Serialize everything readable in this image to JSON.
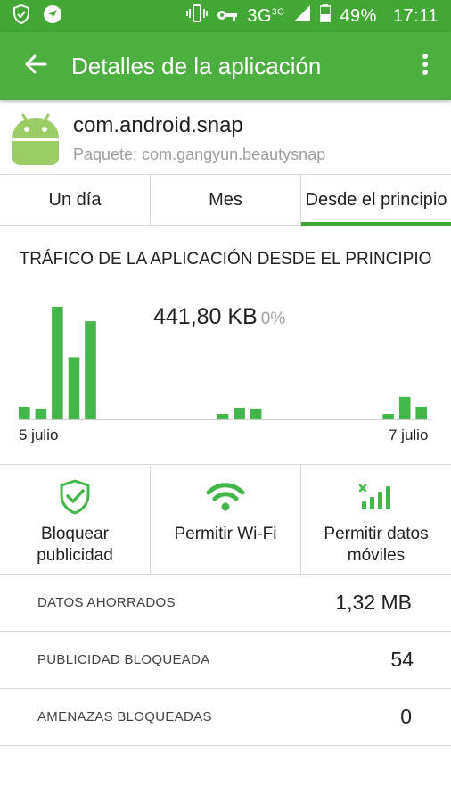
{
  "status_bar": {
    "network": "3G",
    "network_sup": "3G",
    "battery": "49%",
    "time": "17:11"
  },
  "app_bar": {
    "title": "Detalles de la aplicación"
  },
  "app": {
    "name": "com.android.snap",
    "package": "Paquete: com.gangyun.beautysnap"
  },
  "tabs": [
    {
      "label": "Un día",
      "active": false
    },
    {
      "label": "Mes",
      "active": false
    },
    {
      "label": "Desde el principio",
      "active": true
    }
  ],
  "traffic": {
    "title": "TRÁFICO DE LA APLICACIÓN DESDE EL PRINCIPIO",
    "total": "441,80 KB",
    "percent": "0%"
  },
  "chart_data": {
    "type": "bar",
    "x": [
      0,
      1,
      2,
      3,
      4,
      12,
      13,
      14,
      22,
      23,
      24
    ],
    "values": [
      14,
      12,
      125,
      69,
      109,
      6,
      13,
      12,
      6,
      25,
      14
    ],
    "xlim": [
      0,
      24
    ],
    "ylim": [
      0,
      125
    ],
    "tick_labels": [
      {
        "x": 0,
        "label": "5 julio"
      },
      {
        "x": 24,
        "label": "7 julio"
      }
    ],
    "color": "#43b649"
  },
  "actions": [
    {
      "label": "Bloquear\npublicidad",
      "icon": "shield-check-icon"
    },
    {
      "label": "Permitir Wi-Fi",
      "icon": "wifi-icon"
    },
    {
      "label": "Permitir datos\nmóviles",
      "icon": "mobile-signal-icon"
    }
  ],
  "stats": [
    {
      "label": "DATOS AHORRADOS",
      "value": "1,32 MB"
    },
    {
      "label": "PUBLICIDAD BLOQUEADA",
      "value": "54"
    },
    {
      "label": "AMENAZAS BLOQUEADAS",
      "value": "0"
    }
  ],
  "colors": {
    "primary": "#4caf3f",
    "status_bar": "#43a735",
    "accent": "#43b649"
  }
}
